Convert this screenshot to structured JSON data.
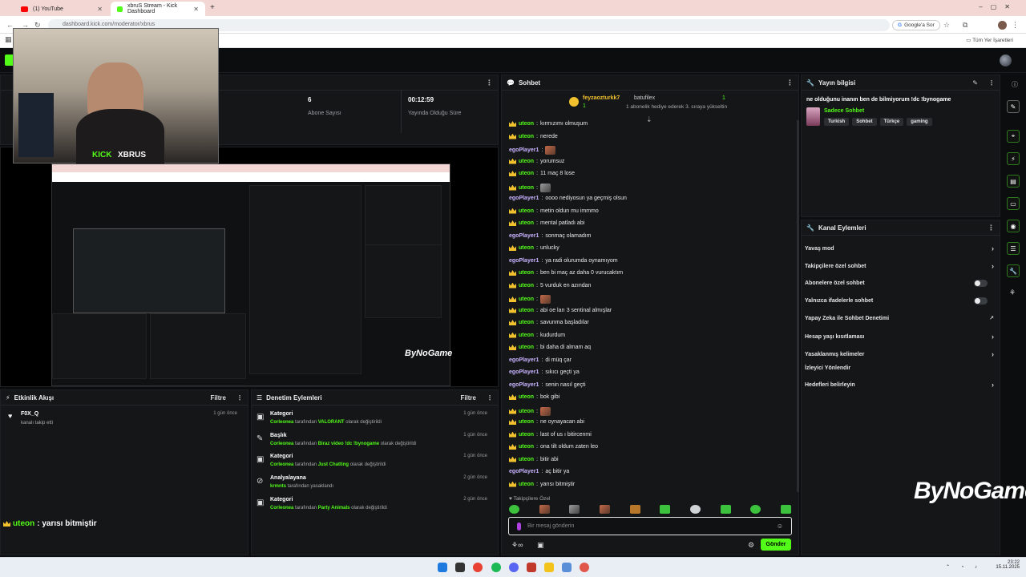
{
  "browser": {
    "tabs": [
      {
        "label": "(1) YouTube"
      },
      {
        "label": "xbruS Stream - Kick Dashboard"
      }
    ],
    "url": "dashboard.kick.com/moderator/xbrus",
    "google_ask": "Google'a Sor",
    "all_bookmarks": "Tüm Yer İşaretleri"
  },
  "webcam": {
    "logo": "KICK",
    "name": "XBRUS"
  },
  "stats": [
    {
      "value": "6",
      "label": "Abone Sayısı"
    },
    {
      "value": "00:12:59",
      "label": "Yayında Olduğu Süre"
    }
  ],
  "preview_watermark": "ByNoGame",
  "chat": {
    "title": "Sohbet",
    "pinned_user": "feyzaozturkk7",
    "pinned_count": "1",
    "gift_user": "batufilex",
    "gift_amount": "1",
    "gift_text": "1 abonelik hediye ederek 3. sıraya yükseltin",
    "messages": [
      {
        "user": "uteon",
        "text": "kırmızımı olmuşum"
      },
      {
        "user": "uteon",
        "text": "nerede"
      },
      {
        "user": "egoPlayer1",
        "text": ""
      },
      {
        "user": "uteon",
        "text": "yorumsuz"
      },
      {
        "user": "uteon",
        "text": "11 maç 8 lose"
      },
      {
        "user": "uteon",
        "text": ""
      },
      {
        "user": "egoPlayer1",
        "text": "oooo nediyosun ya geçmiş olsun"
      },
      {
        "user": "uteon",
        "text": "metin oldun mu immmo"
      },
      {
        "user": "uteon",
        "text": "mental patladı abi"
      },
      {
        "user": "egoPlayer1",
        "text": "sonmaç olamadım"
      },
      {
        "user": "uteon",
        "text": "unlucky"
      },
      {
        "user": "egoPlayer1",
        "text": "ya radi olurumda oynamıyom"
      },
      {
        "user": "uteon",
        "text": "ben bi maç az daha 0 vurucaktım"
      },
      {
        "user": "uteon",
        "text": "5 vurduk en azından"
      },
      {
        "user": "uteon",
        "text": ""
      },
      {
        "user": "uteon",
        "text": "abi oe ları 3 sentinal almışlar"
      },
      {
        "user": "uteon",
        "text": "savunma başladılar"
      },
      {
        "user": "uteon",
        "text": "kudurdum"
      },
      {
        "user": "uteon",
        "text": "bi daha di almam aq"
      },
      {
        "user": "egoPlayer1",
        "text": "di müq çar"
      },
      {
        "user": "egoPlayer1",
        "text": "sıkıcı geçti ya"
      },
      {
        "user": "egoPlayer1",
        "text": "senin nasıl geçti"
      },
      {
        "user": "uteon",
        "text": "bok gibi"
      },
      {
        "user": "uteon",
        "text": ""
      },
      {
        "user": "uteon",
        "text": "ne oynayacan abi"
      },
      {
        "user": "uteon",
        "text": "last of us ı bitircenmi"
      },
      {
        "user": "uteon",
        "text": "ona tilt oldum zaten leo"
      },
      {
        "user": "uteon",
        "text": "bitir abi"
      },
      {
        "user": "egoPlayer1",
        "text": "aç bitir ya"
      },
      {
        "user": "uteon",
        "text": "yarısı bitmiştir"
      }
    ],
    "followers_only": "Takipçilere Özel",
    "input_placeholder": "Bir mesaj gönderin",
    "send": "Gönder"
  },
  "stream_info": {
    "title": "Yayın bilgisi",
    "stream_title": "ne olduğunu inanın ben de bilmiyorum !dc !bynogame",
    "category": "Sadece Sohbet",
    "tags": [
      "Turkish",
      "Sohbet",
      "Türkçe",
      "gaming"
    ]
  },
  "channel_actions": {
    "title": "Kanal Eylemleri",
    "items": [
      {
        "label": "Yavaş mod",
        "control": "chevron"
      },
      {
        "label": "Takipçilere özel sohbet",
        "control": "chevron"
      },
      {
        "label": "Abonelere özel sohbet",
        "control": "toggle"
      },
      {
        "label": "Yalnızca ifadelerle sohbet",
        "control": "toggle"
      },
      {
        "label": "Yapay Zeka ile Sohbet Denetimi",
        "control": "external"
      },
      {
        "label": "Hesap yaşı kısıtlaması",
        "control": "chevron"
      },
      {
        "label": "Yasaklanmış kelimeler",
        "control": "chevron"
      },
      {
        "label": "İzleyici Yönlendir",
        "control": "none"
      },
      {
        "label": "Hedefleri belirleyin",
        "control": "chevron"
      }
    ]
  },
  "activity": {
    "title": "Etkinlik Akışı",
    "filter": "Filtre",
    "items": [
      {
        "user": "F0X_Q",
        "text": "kanalı takip etti",
        "time": "1 gün önce"
      }
    ]
  },
  "overlay_chat": {
    "user": "uteon",
    "text": " : yarısı bitmiştir"
  },
  "moderation": {
    "title": "Denetim Eylemleri",
    "filter": "Filtre",
    "items": [
      {
        "title": "Kategori",
        "actor": "Corleonea",
        "mid": " tarafından ",
        "value": "VALORANT",
        "end": " olarak değiştirildi",
        "time": "1 gün önce"
      },
      {
        "title": "Başlık",
        "actor": "Corleonea",
        "mid": " tarafından ",
        "value": "Biraz video !dc !bynogame",
        "end": " olarak değiştirildi",
        "time": "1 gün önce"
      },
      {
        "title": "Kategori",
        "actor": "Corleonea",
        "mid": " tarafından ",
        "value": "Just Chatting",
        "end": " olarak değiştirildi",
        "time": "1 gün önce"
      },
      {
        "title": "Analyalayana",
        "actor": "krmnts",
        "mid": " tarafından yasaklandı",
        "value": "",
        "end": "",
        "time": "2 gün önce"
      },
      {
        "title": "Kategori",
        "actor": "Corleonea",
        "mid": " tarafından ",
        "value": "Party Animals",
        "end": " olarak değiştirildi",
        "time": "2 gün önce"
      }
    ]
  },
  "taskbar": {
    "time": "23:22",
    "date": "15.11.2025"
  },
  "colors": {
    "accent": "#53fc18",
    "gold": "#f2c12e",
    "ego": "#c9b3ff"
  }
}
